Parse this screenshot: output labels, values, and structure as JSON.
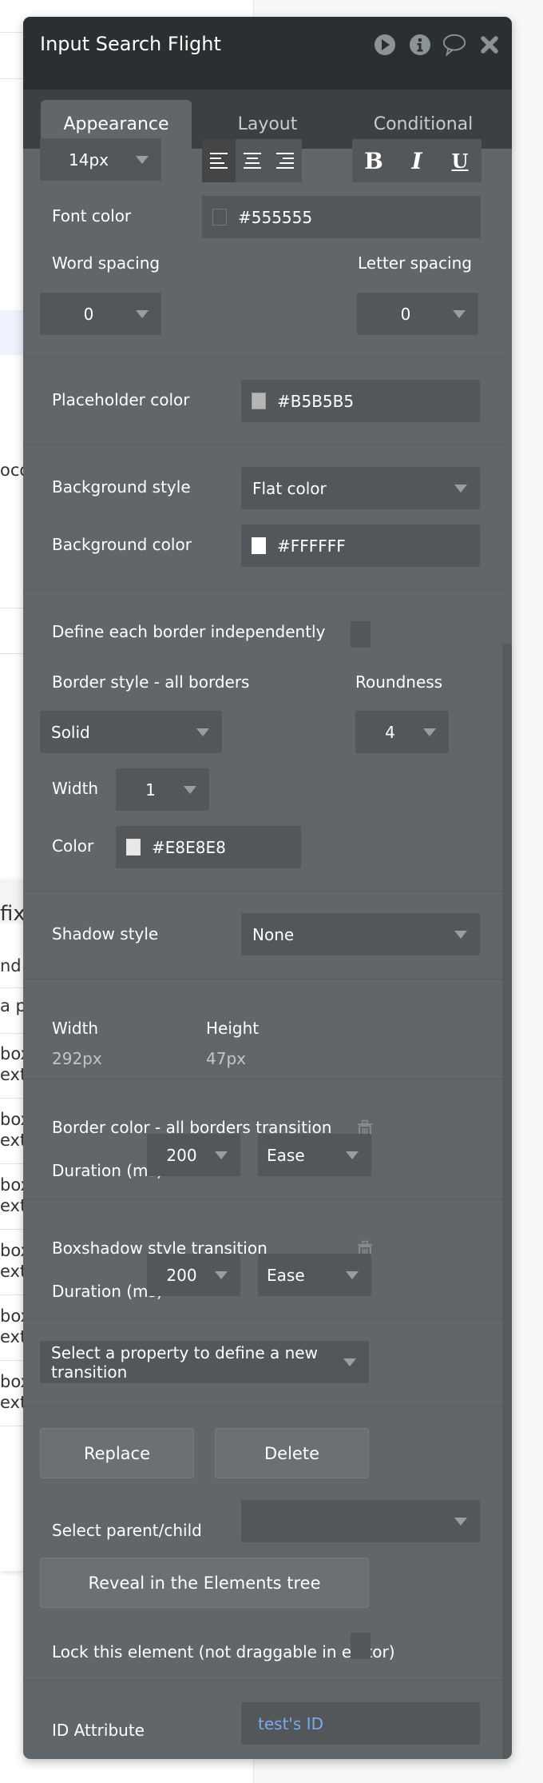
{
  "background": {
    "fragments": [
      {
        "text": "oco",
        "top": 0
      },
      {
        "text": "fix",
        "top": 0
      },
      {
        "text": "nd",
        "top": 0
      },
      {
        "text": "a p",
        "top": 0
      },
      {
        "text": "box\next",
        "top": 0
      },
      {
        "text": "box\next",
        "top": 0
      },
      {
        "text": "box\next",
        "top": 0
      },
      {
        "text": "box\next",
        "top": 0
      },
      {
        "text": "box\next",
        "top": 0
      },
      {
        "text": "box\next",
        "top": 0
      }
    ]
  },
  "panel": {
    "title": "Input Search Flight",
    "header_icons": [
      "play-icon",
      "info-icon",
      "comment-icon",
      "close-icon"
    ],
    "tabs": [
      {
        "label": "Appearance",
        "active": true
      },
      {
        "label": "Layout",
        "active": false
      },
      {
        "label": "Conditional",
        "active": false
      }
    ]
  },
  "appearance": {
    "font_size": "14px",
    "text_align": {
      "options": [
        "left",
        "center",
        "right"
      ],
      "selected": "left"
    },
    "format": {
      "bold": "B",
      "italic": "I",
      "underline": "U"
    },
    "font_color_label": "Font color",
    "font_color": "#555555",
    "word_spacing_label": "Word spacing",
    "word_spacing": "0",
    "letter_spacing_label": "Letter spacing",
    "letter_spacing": "0",
    "placeholder_color_label": "Placeholder color",
    "placeholder_color": "#B5B5B5",
    "background_style_label": "Background style",
    "background_style": "Flat color",
    "background_color_label": "Background color",
    "background_color": "#FFFFFF",
    "define_borders_label": "Define each border independently",
    "define_borders_checked": false,
    "border_style_label": "Border style - all borders",
    "border_style": "Solid",
    "roundness_label": "Roundness",
    "roundness": "4",
    "border_width_label": "Width",
    "border_width": "1",
    "border_color_label": "Color",
    "border_color": "#E8E8E8",
    "shadow_style_label": "Shadow style",
    "shadow_style": "None",
    "width_label": "Width",
    "width_value": "292px",
    "height_label": "Height",
    "height_value": "47px",
    "transitions": [
      {
        "title": "Border color - all borders transition",
        "duration_label": "Duration (ms)",
        "duration": "200",
        "easing": "Ease"
      },
      {
        "title": "Boxshadow style transition",
        "duration_label": "Duration (ms)",
        "duration": "200",
        "easing": "Ease"
      }
    ],
    "new_transition_placeholder": "Select a property to define a new transition",
    "replace_label": "Replace",
    "delete_label": "Delete",
    "select_parent_child_label": "Select parent/child",
    "select_parent_child_value": "",
    "reveal_label": "Reveal in the Elements tree",
    "lock_label": "Lock this element (not draggable in editor)",
    "lock_checked": false,
    "id_attribute_label": "ID Attribute",
    "id_attribute_value": "test's ID"
  },
  "colors": {
    "header_bg": "#2b2f31",
    "tabbar_bg": "#3c4043",
    "panel_bg": "#61666a",
    "field_bg": "#53575a",
    "id_link": "#7aaaf0"
  }
}
